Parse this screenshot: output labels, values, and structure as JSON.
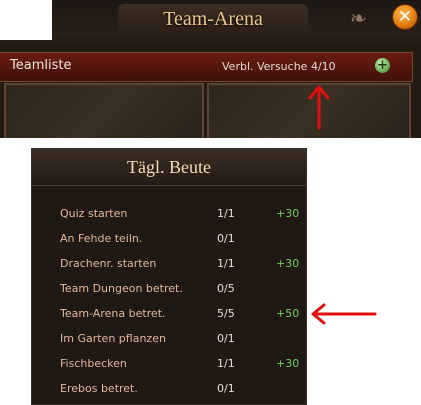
{
  "window": {
    "title": "Team-Arena",
    "close_symbol": "✕",
    "teamliste_label": "Teamliste",
    "versuche_label": "Verbl. Versuche 4/10",
    "plus_symbol": "+"
  },
  "beute": {
    "title": "Tägl. Beute",
    "rows": [
      {
        "task": "Quiz starten",
        "count": "1/1",
        "bonus": "+30"
      },
      {
        "task": "An Fehde teiln.",
        "count": "0/1",
        "bonus": ""
      },
      {
        "task": "Drachenr. starten",
        "count": "1/1",
        "bonus": "+30"
      },
      {
        "task": "Team Dungeon betret.",
        "count": "0/5",
        "bonus": ""
      },
      {
        "task": "Team-Arena betret.",
        "count": "5/5",
        "bonus": "+50"
      },
      {
        "task": "Im Garten pflanzen",
        "count": "0/1",
        "bonus": ""
      },
      {
        "task": "Fischbecken",
        "count": "1/1",
        "bonus": "+30"
      },
      {
        "task": "Erebos betret.",
        "count": "0/1",
        "bonus": ""
      }
    ]
  },
  "icons": {
    "close": "close-icon",
    "plus": "plus-icon",
    "arrow_up": "red-arrow-up-icon",
    "arrow_left": "red-arrow-left-icon"
  },
  "colors": {
    "title_gold": "#ecc88c",
    "bonus_green": "#6fd15c",
    "task_text": "#e2b79c",
    "arrow_red": "#e01010",
    "close_orange": "#e07a10"
  }
}
